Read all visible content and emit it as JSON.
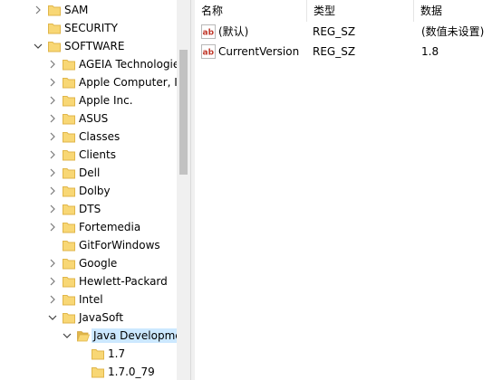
{
  "tree": {
    "items": [
      {
        "label": "SAM",
        "expanded": false
      },
      {
        "label": "SECURITY",
        "expanded": false
      },
      {
        "label": "SOFTWARE",
        "expanded": true
      },
      {
        "label": "AGEIA Technologie",
        "expanded": false
      },
      {
        "label": "Apple Computer, I",
        "expanded": false
      },
      {
        "label": "Apple Inc.",
        "expanded": false
      },
      {
        "label": "ASUS",
        "expanded": false
      },
      {
        "label": "Classes",
        "expanded": false
      },
      {
        "label": "Clients",
        "expanded": false
      },
      {
        "label": "Dell",
        "expanded": false
      },
      {
        "label": "Dolby",
        "expanded": false
      },
      {
        "label": "DTS",
        "expanded": false
      },
      {
        "label": "Fortemedia",
        "expanded": false
      },
      {
        "label": "GitForWindows",
        "expanded": false
      },
      {
        "label": "Google",
        "expanded": false
      },
      {
        "label": "Hewlett-Packard",
        "expanded": false
      },
      {
        "label": "Intel",
        "expanded": false
      },
      {
        "label": "JavaSoft",
        "expanded": true
      },
      {
        "label": "Java Developme",
        "expanded": true,
        "selected": true
      },
      {
        "label": "1.7",
        "expanded": false
      },
      {
        "label": "1.7.0_79",
        "expanded": false
      }
    ]
  },
  "values": {
    "headers": {
      "name": "名称",
      "type": "类型",
      "data": "数据"
    },
    "rows": [
      {
        "icon": "ab",
        "name": "(默认)",
        "type": "REG_SZ",
        "data": "(数值未设置)"
      },
      {
        "icon": "ab",
        "name": "CurrentVersion",
        "type": "REG_SZ",
        "data": "1.8"
      }
    ]
  },
  "colors": {
    "selection": "#cce8ff",
    "folder": "#f8d775",
    "folder_dark": "#e0b64a",
    "ab_icon": "#c0392b"
  }
}
